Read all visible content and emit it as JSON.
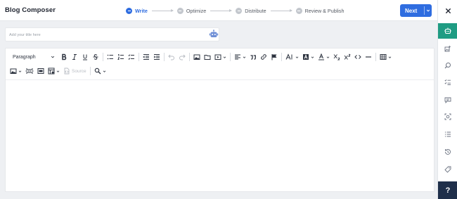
{
  "header": {
    "title": "Blog Composer",
    "steps": [
      {
        "label": "Write",
        "active": true
      },
      {
        "label": "Optimize",
        "active": false
      },
      {
        "label": "Distribute",
        "active": false
      },
      {
        "label": "Review & Publish",
        "active": false
      }
    ],
    "next_label": "Next"
  },
  "title_field": {
    "placeholder": "Add your title here",
    "value": ""
  },
  "toolbar": {
    "paragraph_label": "Paragraph",
    "source_label": "Source"
  },
  "rail": {
    "help_label": "?"
  },
  "colors": {
    "accent": "#2f6de0",
    "rail_active": "#1f9c83",
    "help_bg": "#1f2f4a"
  },
  "icons": [
    "close-icon",
    "ai-assistant-icon",
    "ai-image-icon",
    "seo-search-icon",
    "checklist-icon",
    "comment-icon",
    "focus-scan-icon",
    "outline-list-icon",
    "history-icon",
    "tag-icon",
    "robot-icon"
  ]
}
